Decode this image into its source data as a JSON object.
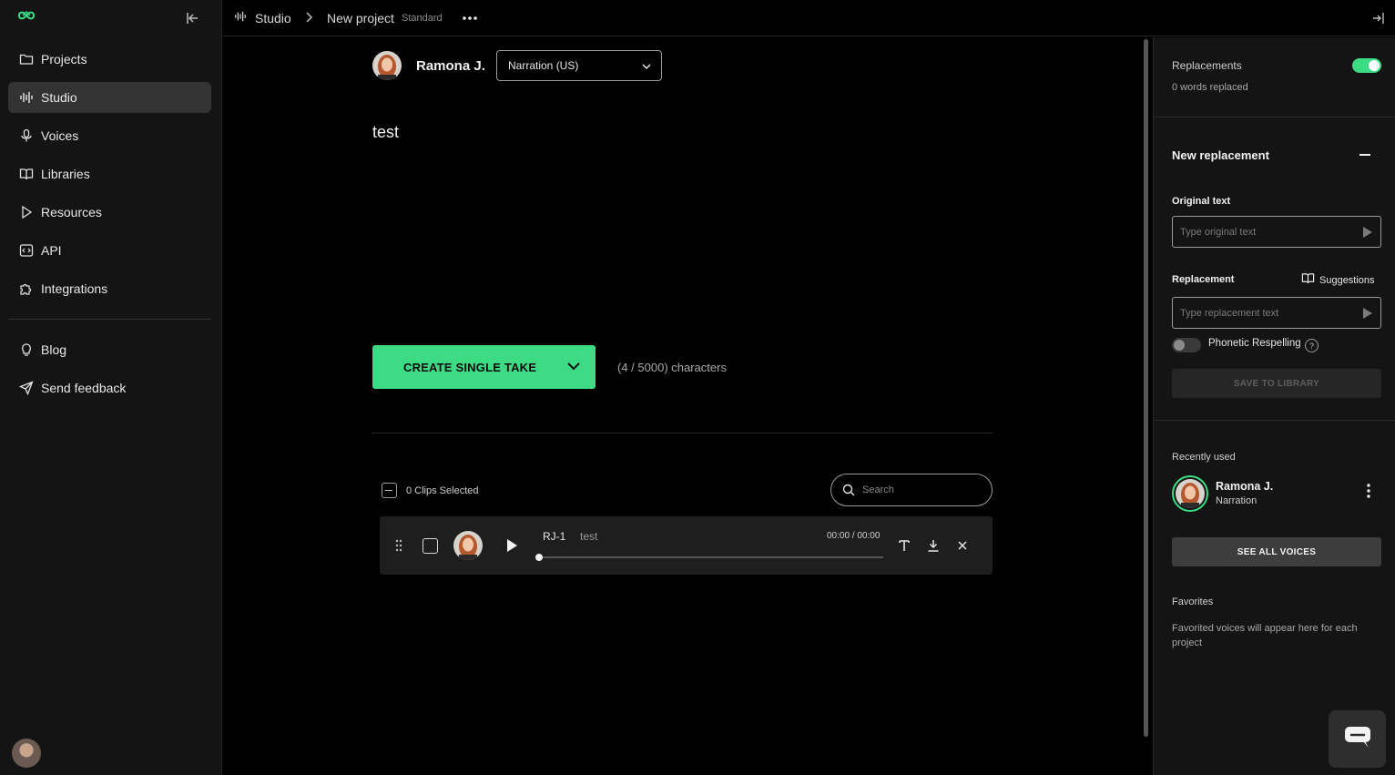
{
  "sidebar": {
    "items": [
      {
        "label": "Projects",
        "icon": "folder-icon"
      },
      {
        "label": "Studio",
        "icon": "waveform-icon",
        "active": true
      },
      {
        "label": "Voices",
        "icon": "microphone-icon"
      },
      {
        "label": "Libraries",
        "icon": "book-icon"
      },
      {
        "label": "Resources",
        "icon": "play-triangle-icon"
      },
      {
        "label": "API",
        "icon": "code-icon"
      },
      {
        "label": "Integrations",
        "icon": "puzzle-icon"
      }
    ],
    "secondary": [
      {
        "label": "Blog",
        "icon": "lightbulb-icon"
      },
      {
        "label": "Send feedback",
        "icon": "send-icon"
      }
    ]
  },
  "topbar": {
    "studio": "Studio",
    "project": "New project",
    "plan": "Standard"
  },
  "editor": {
    "voice_name": "Ramona J.",
    "style_value": "Narration (US)",
    "text": "test",
    "create_label": "CREATE SINGLE TAKE",
    "char_count": "(4 / 5000) characters"
  },
  "clips": {
    "selected_label": "0 Clips Selected",
    "search_placeholder": "Search",
    "rows": [
      {
        "id": "RJ-1",
        "text": "test",
        "time": "00:00 / 00:00",
        "progress": 0
      }
    ]
  },
  "right_panel": {
    "replacements_label": "Replacements",
    "replacements_enabled": true,
    "words_replaced": "0 words replaced",
    "new_replacement": "New replacement",
    "original_text_label": "Original text",
    "original_placeholder": "Type original text",
    "replacement_label": "Replacement",
    "suggestions_label": "Suggestions",
    "replacement_placeholder": "Type replacement text",
    "phonetic_label": "Phonetic Respelling",
    "phonetic_enabled": false,
    "help_glyph": "?",
    "save_label": "SAVE TO LIBRARY",
    "recently_used_label": "Recently used",
    "recent_voice_name": "Ramona J.",
    "recent_voice_style": "Narration",
    "see_all_label": "SEE ALL VOICES",
    "favorites_label": "Favorites",
    "favorites_empty": "Favorited voices will appear here for each project"
  },
  "colors": {
    "accent": "#3ddc84",
    "sidebar_bg": "#141414",
    "main_bg": "#000000"
  }
}
